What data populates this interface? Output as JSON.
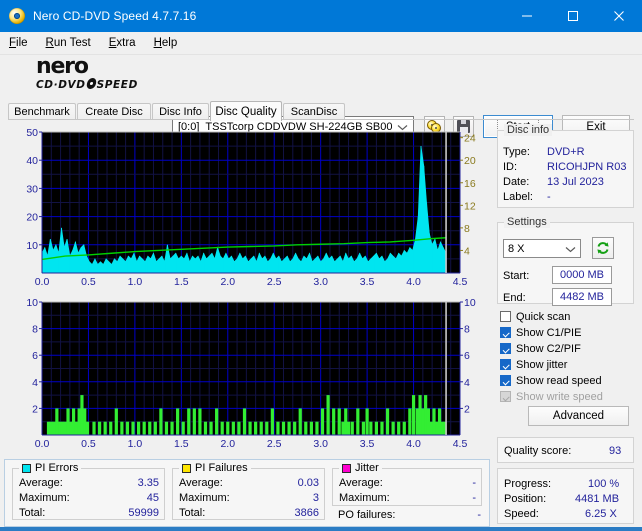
{
  "window": {
    "title": "Nero CD-DVD Speed 4.7.7.16",
    "app_icon": "disc-icon",
    "minimize": "—",
    "maximize": "□",
    "close": "×",
    "titlebar_color": "#0078d7"
  },
  "menu": [
    {
      "label": "File",
      "accel": "F"
    },
    {
      "label": "Run Test",
      "accel": "R"
    },
    {
      "label": "Extra",
      "accel": "E"
    },
    {
      "label": "Help",
      "accel": "H"
    }
  ],
  "logo": {
    "line1": "nero",
    "line2_left": "CD·DVD",
    "line2_right": "SPEED"
  },
  "toolbar": {
    "drive_slot": "[0:0]",
    "drive_name": "TSSTcorp CDDVDW SH-224GB SB00",
    "eject_icon": "disc-eject-icon",
    "save_icon": "floppy-save-icon",
    "start_label": "Start",
    "exit_label": "Exit"
  },
  "tabs": [
    {
      "label": "Benchmark",
      "active": false
    },
    {
      "label": "Create Disc",
      "active": false
    },
    {
      "label": "Disc Info",
      "active": false
    },
    {
      "label": "Disc Quality",
      "active": true
    },
    {
      "label": "ScanDisc",
      "active": false
    }
  ],
  "disc_info": {
    "caption": "Disc info",
    "type_label": "Type:",
    "type_value": "DVD+R",
    "id_label": "ID:",
    "id_value": "RICOHJPN R03",
    "date_label": "Date:",
    "date_value": "13 Jul 2023",
    "label_label": "Label:",
    "label_value": "-"
  },
  "settings": {
    "caption": "Settings",
    "speed_value": "8 X",
    "refresh_icon": "refresh-icon",
    "start_label": "Start:",
    "start_value": "0000 MB",
    "end_label": "End:",
    "end_value": "4482 MB"
  },
  "options": [
    {
      "label": "Quick scan",
      "checked": false,
      "disabled": false
    },
    {
      "label": "Show C1/PIE",
      "checked": true,
      "disabled": false
    },
    {
      "label": "Show C2/PIF",
      "checked": true,
      "disabled": false
    },
    {
      "label": "Show jitter",
      "checked": true,
      "disabled": false
    },
    {
      "label": "Show read speed",
      "checked": true,
      "disabled": false
    },
    {
      "label": "Show write speed",
      "checked": true,
      "disabled": true
    }
  ],
  "advanced_label": "Advanced",
  "quality": {
    "label": "Quality score:",
    "value": "93"
  },
  "progress": {
    "progress_label": "Progress:",
    "progress_value": "100 %",
    "position_label": "Position:",
    "position_value": "4481 MB",
    "speed_label": "Speed:",
    "speed_value": "6.25 X"
  },
  "stats": {
    "pi_errors": {
      "caption": "PI Errors",
      "color": "#00e5f0",
      "rows": [
        {
          "label": "Average:",
          "value": "3.35"
        },
        {
          "label": "Maximum:",
          "value": "45"
        },
        {
          "label": "Total:",
          "value": "59999"
        }
      ]
    },
    "pi_failures": {
      "caption": "PI Failures",
      "color": "#ffe600",
      "rows": [
        {
          "label": "Average:",
          "value": "0.03"
        },
        {
          "label": "Maximum:",
          "value": "3"
        },
        {
          "label": "Total:",
          "value": "3866"
        }
      ]
    },
    "jitter": {
      "caption": "Jitter",
      "color": "#ff00d0",
      "rows": [
        {
          "label": "Average:",
          "value": "-"
        },
        {
          "label": "Maximum:",
          "value": "-"
        }
      ],
      "po_label": "PO failures:",
      "po_value": "-"
    }
  },
  "chart_data": [
    {
      "type": "area",
      "name": "pi-errors-chart",
      "title": "",
      "xlabel": "",
      "ylabel": "PI Errors",
      "xlim": [
        0.0,
        4.5
      ],
      "ylim": [
        0,
        50
      ],
      "y2lim": [
        0,
        25
      ],
      "xticks": [
        0.0,
        0.5,
        1.0,
        1.5,
        2.0,
        2.5,
        3.0,
        3.5,
        4.0,
        4.5
      ],
      "xticklabels": [
        "0.0",
        "0.5",
        "1.0",
        "1.5",
        "2.0",
        "2.5",
        "3.0",
        "3.5",
        "4.0",
        "4.5"
      ],
      "yticks": [
        10,
        20,
        30,
        40,
        50
      ],
      "yticklabels": [
        "10",
        "20",
        "30",
        "40",
        "50"
      ],
      "y2ticks": [
        4,
        8,
        12,
        16,
        20,
        24
      ],
      "y2ticklabels": [
        "4",
        "8",
        "12",
        "16",
        "20",
        "24"
      ],
      "grid": true,
      "plot_bg": "#000000",
      "grid_color": "#0000c8",
      "cursor_x": 4.35,
      "series": [
        {
          "name": "PI Errors",
          "color": "#00e5f0",
          "kind": "area",
          "x": [
            0.0,
            0.03,
            0.06,
            0.09,
            0.12,
            0.15,
            0.18,
            0.21,
            0.24,
            0.27,
            0.3,
            0.33,
            0.36,
            0.39,
            0.42,
            0.45,
            0.48,
            0.51,
            0.54,
            0.57,
            0.6,
            0.63,
            0.66,
            0.69,
            0.72,
            0.75,
            0.78,
            0.81,
            0.84,
            0.87,
            0.9,
            0.93,
            0.96,
            0.99,
            1.02,
            1.05,
            1.08,
            1.11,
            1.14,
            1.17,
            1.2,
            1.23,
            1.26,
            1.29,
            1.32,
            1.35,
            1.38,
            1.41,
            1.44,
            1.47,
            1.5,
            1.53,
            1.56,
            1.59,
            1.62,
            1.65,
            1.68,
            1.71,
            1.74,
            1.77,
            1.8,
            1.83,
            1.86,
            1.89,
            1.92,
            1.95,
            1.98,
            2.01,
            2.04,
            2.07,
            2.1,
            2.13,
            2.16,
            2.19,
            2.22,
            2.25,
            2.28,
            2.31,
            2.34,
            2.37,
            2.4,
            2.43,
            2.46,
            2.49,
            2.52,
            2.55,
            2.58,
            2.61,
            2.64,
            2.67,
            2.7,
            2.73,
            2.76,
            2.79,
            2.82,
            2.85,
            2.88,
            2.91,
            2.94,
            2.97,
            3.0,
            3.03,
            3.06,
            3.09,
            3.12,
            3.15,
            3.18,
            3.21,
            3.24,
            3.27,
            3.3,
            3.33,
            3.36,
            3.39,
            3.42,
            3.45,
            3.48,
            3.51,
            3.54,
            3.57,
            3.6,
            3.63,
            3.66,
            3.69,
            3.72,
            3.75,
            3.78,
            3.81,
            3.84,
            3.87,
            3.9,
            3.93,
            3.96,
            3.99,
            4.02,
            4.05,
            4.08,
            4.11,
            4.14,
            4.17,
            4.2,
            4.23,
            4.26,
            4.29,
            4.32,
            4.35
          ],
          "y": [
            7,
            9,
            6,
            12,
            8,
            10,
            7,
            16,
            9,
            12,
            6,
            8,
            11,
            7,
            9,
            10,
            6,
            4,
            3,
            5,
            3,
            4,
            3,
            5,
            4,
            3,
            5,
            4,
            6,
            5,
            4,
            6,
            5,
            7,
            4,
            6,
            5,
            4,
            6,
            5,
            7,
            4,
            5,
            6,
            4,
            10,
            5,
            6,
            7,
            5,
            6,
            5,
            7,
            4,
            6,
            5,
            6,
            4,
            7,
            5,
            6,
            7,
            5,
            9,
            6,
            5,
            7,
            5,
            6,
            4,
            5,
            7,
            5,
            6,
            4,
            5,
            6,
            4,
            7,
            5,
            6,
            4,
            5,
            7,
            5,
            6,
            4,
            5,
            6,
            4,
            5,
            7,
            5,
            4,
            6,
            5,
            7,
            4,
            5,
            6,
            4,
            5,
            7,
            5,
            6,
            4,
            5,
            6,
            4,
            7,
            5,
            6,
            4,
            5,
            7,
            5,
            6,
            4,
            5,
            6,
            7,
            5,
            6,
            4,
            5,
            7,
            6,
            5,
            7,
            6,
            8,
            7,
            9,
            8,
            12,
            20,
            45,
            38,
            25,
            14,
            10,
            12,
            8,
            11,
            9,
            7
          ]
        },
        {
          "name": "Read speed",
          "color": "#00d000",
          "kind": "line",
          "x": [
            0.0,
            0.25,
            0.5,
            0.75,
            1.0,
            1.25,
            1.5,
            1.75,
            2.0,
            2.25,
            2.5,
            2.75,
            3.0,
            3.25,
            3.5,
            3.75,
            4.0,
            4.2,
            4.35
          ],
          "y": [
            2.4,
            3.0,
            3.2,
            3.5,
            3.8,
            4.0,
            4.2,
            4.4,
            4.6,
            4.7,
            4.8,
            5.0,
            5.1,
            5.2,
            5.4,
            5.5,
            5.8,
            6.1,
            6.25
          ],
          "axis": "y2"
        }
      ]
    },
    {
      "type": "bar",
      "name": "pi-failures-chart",
      "title": "",
      "xlabel": "",
      "ylabel": "PI Failures",
      "xlim": [
        0.0,
        4.5
      ],
      "ylim": [
        0,
        10
      ],
      "xticks": [
        0.0,
        0.5,
        1.0,
        1.5,
        2.0,
        2.5,
        3.0,
        3.5,
        4.0,
        4.5
      ],
      "xticklabels": [
        "0.0",
        "0.5",
        "1.0",
        "1.5",
        "2.0",
        "2.5",
        "3.0",
        "3.5",
        "4.0",
        "4.5"
      ],
      "yticks": [
        2,
        4,
        6,
        8,
        10
      ],
      "yticklabels": [
        "2",
        "4",
        "6",
        "8",
        "10"
      ],
      "y2ticks": [
        2,
        4,
        6,
        8,
        10
      ],
      "y2ticklabels": [
        "2",
        "4",
        "6",
        "8",
        "10"
      ],
      "grid": true,
      "plot_bg": "#000000",
      "grid_color": "#0000c8",
      "cursor_x": 4.35,
      "series": [
        {
          "name": "PI Failures",
          "color": "#33ee33",
          "kind": "bar",
          "x": [
            0.07,
            0.1,
            0.13,
            0.16,
            0.19,
            0.22,
            0.25,
            0.28,
            0.31,
            0.34,
            0.37,
            0.4,
            0.43,
            0.46,
            0.49,
            0.56,
            0.62,
            0.68,
            0.74,
            0.8,
            0.86,
            0.92,
            0.98,
            1.04,
            1.1,
            1.16,
            1.22,
            1.28,
            1.34,
            1.4,
            1.46,
            1.52,
            1.58,
            1.64,
            1.7,
            1.76,
            1.82,
            1.88,
            1.94,
            2.0,
            2.06,
            2.12,
            2.18,
            2.24,
            2.3,
            2.36,
            2.42,
            2.48,
            2.54,
            2.6,
            2.66,
            2.72,
            2.78,
            2.84,
            2.9,
            2.96,
            3.02,
            3.08,
            3.14,
            3.2,
            3.24,
            3.27,
            3.3,
            3.34,
            3.4,
            3.46,
            3.5,
            3.54,
            3.6,
            3.66,
            3.72,
            3.78,
            3.84,
            3.9,
            3.96,
            4.0,
            4.04,
            4.07,
            4.1,
            4.13,
            4.16,
            4.19,
            4.22,
            4.25,
            4.28,
            4.31,
            4.34
          ],
          "y": [
            1,
            1,
            1,
            2,
            1,
            1,
            1,
            2,
            1,
            2,
            1,
            2,
            3,
            2,
            1,
            1,
            1,
            1,
            1,
            2,
            1,
            1,
            1,
            1,
            1,
            1,
            1,
            2,
            1,
            1,
            2,
            1,
            2,
            2,
            2,
            1,
            1,
            2,
            1,
            1,
            1,
            1,
            2,
            1,
            1,
            1,
            1,
            2,
            1,
            1,
            1,
            1,
            2,
            1,
            1,
            1,
            2,
            3,
            2,
            2,
            1,
            2,
            1,
            1,
            2,
            1,
            2,
            1,
            1,
            1,
            2,
            1,
            1,
            1,
            2,
            3,
            2,
            3,
            2,
            3,
            2,
            1,
            2,
            1,
            2,
            1,
            1
          ]
        }
      ]
    }
  ]
}
